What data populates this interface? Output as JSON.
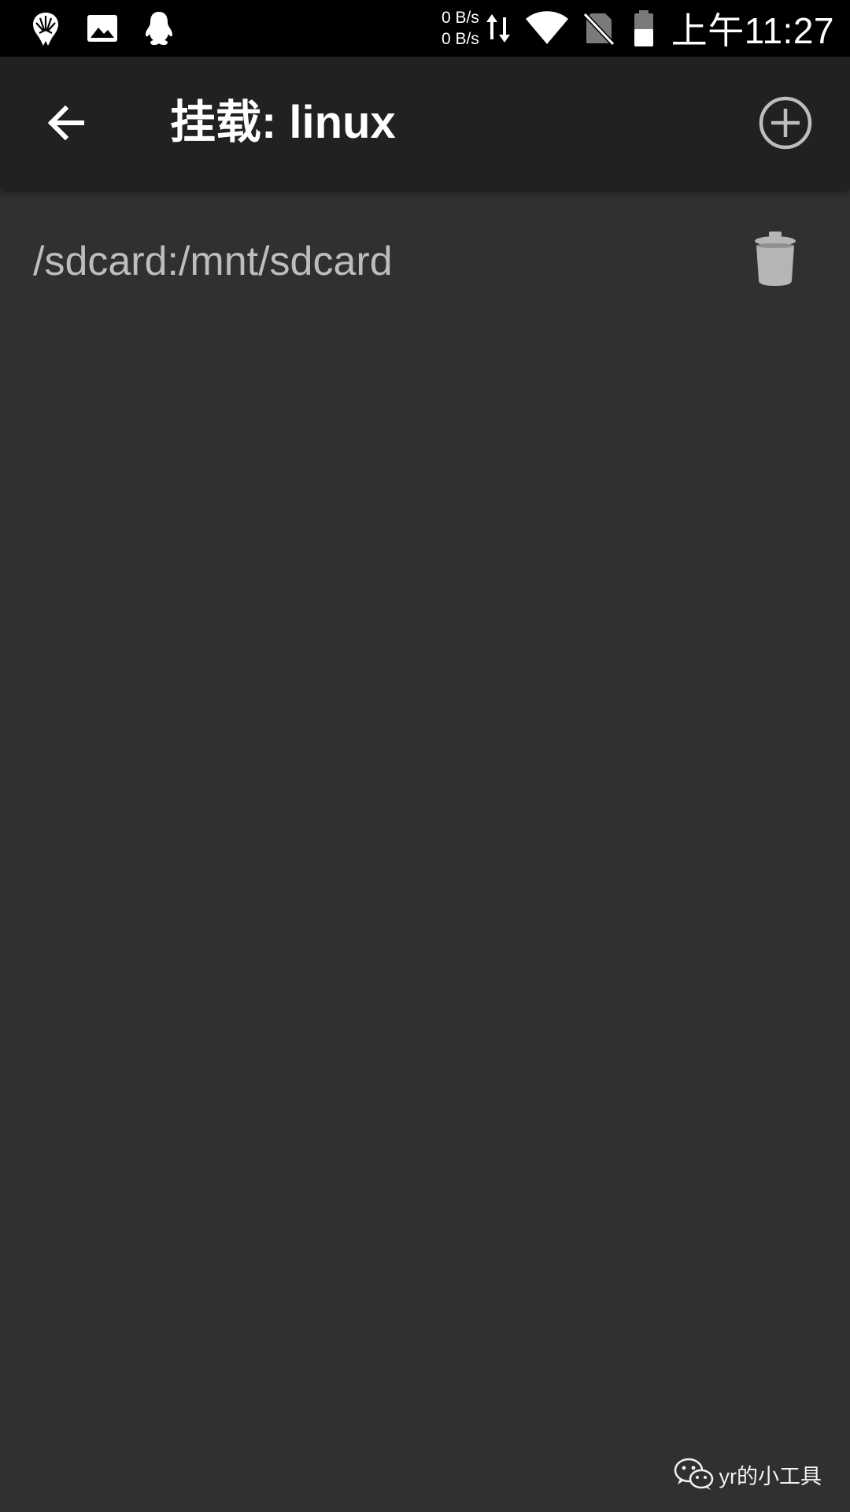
{
  "status_bar": {
    "net_up": "0 B/s",
    "net_down": "0 B/s",
    "time": "上午11:27",
    "left_icons": [
      "mask-app-icon",
      "gallery-icon",
      "qq-penguin-icon"
    ],
    "right_icons": [
      "data-transfer-icon",
      "wifi-icon",
      "no-sim-icon",
      "battery-icon"
    ]
  },
  "app_bar": {
    "title": "挂载: linux",
    "back_icon": "arrow-left-icon",
    "add_icon": "circle-plus-icon"
  },
  "mounts": [
    {
      "path": "/sdcard:/mnt/sdcard",
      "action_icon": "trash-icon"
    }
  ],
  "watermark": {
    "text": "yr的小工具",
    "icon": "wechat-icon"
  },
  "colors": {
    "status_bar_bg": "#000000",
    "app_bar_bg": "#212121",
    "content_bg": "#303030",
    "title_text": "#ffffff",
    "mount_text": "#bdbdbd",
    "icon_gray": "#bdbdbd"
  }
}
